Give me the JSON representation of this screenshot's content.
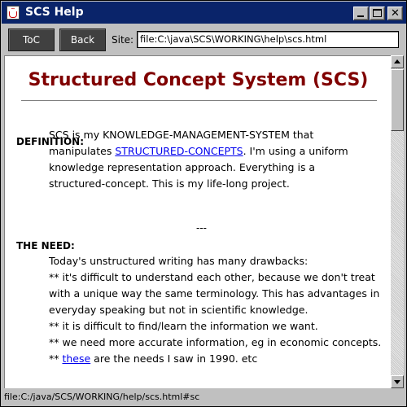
{
  "window": {
    "title": "SCS Help"
  },
  "toolbar": {
    "toc_label": "ToC",
    "back_label": "Back",
    "site_label": "Site:",
    "site_value": "file:C:\\java\\SCS\\WORKING\\help\\scs.html"
  },
  "page": {
    "title": "Structured Concept System (SCS)",
    "definition": {
      "heading": "DEFINITION:",
      "line1": "SCS is my KNOWLEDGE-MANAGEMENT-SYSTEM that",
      "line2_before": "manipulates ",
      "line2_link": "STRUCTURED-CONCEPTS",
      "line2_after": ". I'm using a uniform",
      "line3": "knowledge representation approach. Everything is a",
      "line4": "structured-concept. This is my life-long project."
    },
    "separator": "---",
    "need": {
      "heading": "THE NEED:",
      "line1": "Today's unstructured writing has many drawbacks:",
      "line2": "** it's difficult to understand each other, because we don't treat",
      "line3": "with a unique way the same terminology. This has advantages in",
      "line4": "everyday speaking but not in scientific knowledge.",
      "line5": "** it is difficult to find/learn the information we want.",
      "line6": "** we need more accurate information, eg in economic concepts.",
      "line7_before": "** ",
      "line7_link": "these",
      "line7_after": " are the needs I saw in 1990. etc"
    }
  },
  "status": {
    "text": "file:C:/java/SCS/WORKING/help/scs.html#sc"
  },
  "colors": {
    "title_bar": "#0a246a",
    "heading": "#800000",
    "link": "#0000ee",
    "button": "#404040"
  }
}
